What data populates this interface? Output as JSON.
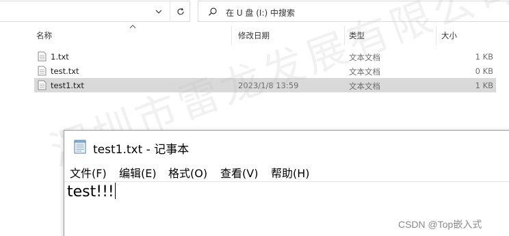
{
  "explorer": {
    "search_placeholder": "在 U 盘 (I:) 中搜索",
    "columns": {
      "name": "名称",
      "modified": "修改日期",
      "type": "类型",
      "size": "大小"
    },
    "files": [
      {
        "name": "1.txt",
        "modified": "",
        "type": "文本文档",
        "size": "1 KB"
      },
      {
        "name": "test.txt",
        "modified": "",
        "type": "文本文档",
        "size": "0 KB"
      },
      {
        "name": "test1.txt",
        "modified": "2023/1/8 13:59",
        "type": "文本文档",
        "size": "1 KB"
      }
    ]
  },
  "notepad": {
    "title": "test1.txt - 记事本",
    "menu": [
      "文件(F)",
      "编辑(E)",
      "格式(O)",
      "查看(V)",
      "帮助(H)"
    ],
    "content": "test!!!"
  },
  "watermarks": {
    "diagonal": "深圳市雷龙发展有限公司",
    "footer": "CSDN @Top嵌入式"
  }
}
